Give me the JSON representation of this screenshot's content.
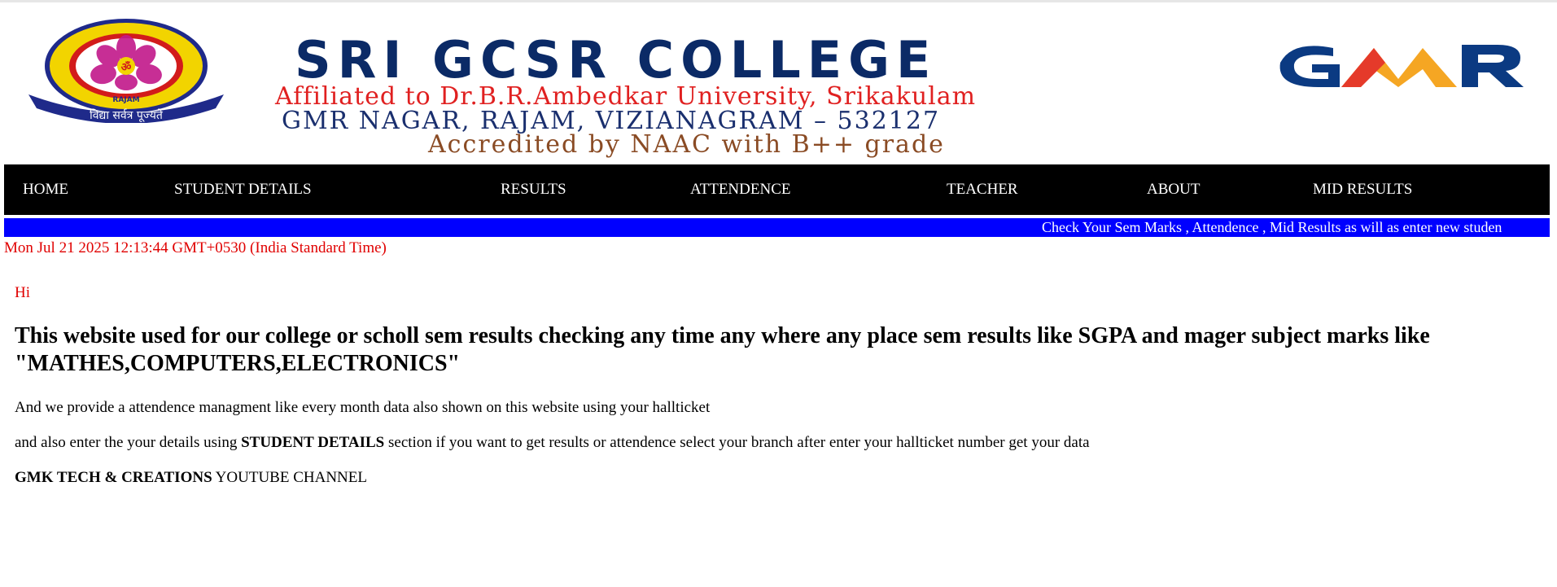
{
  "header": {
    "title": "SRI GCSR COLLEGE",
    "affiliation": "Affiliated to Dr.B.R.Ambedkar University, Srikakulam",
    "address": "GMR NAGAR, RAJAM, VIZIANAGRAM – 532127",
    "accreditation": "Accredited by NAAC with B++ grade",
    "logo_text_outer": "SRI GRANDHI CHINA SANYASIRAJU COLLEGE",
    "logo_text_inner": "RAJAM",
    "logo_motto": "विद्या सर्वत्र पूज्यते",
    "brand_logo_text": "GMR"
  },
  "nav": {
    "items": [
      {
        "label": "HOME"
      },
      {
        "label": "STUDENT DETAILS"
      },
      {
        "label": "RESULTS"
      },
      {
        "label": "ATTENDENCE"
      },
      {
        "label": "TEACHER"
      },
      {
        "label": "ABOUT"
      },
      {
        "label": "MID RESULTS"
      }
    ]
  },
  "marquee": {
    "text": "Check Your Sem Marks , Attendence , Mid Results as will as enter new studen"
  },
  "datetime": "Mon Jul 21 2025 12:13:44 GMT+0530 (India Standard Time)",
  "content": {
    "greeting": "Hi",
    "heading": "This website used for our college or scholl sem results checking any time any where any place sem results like SGPA and mager subject marks like \"MATHES,COMPUTERS,ELECTRONICS\"",
    "para1": "And we provide a attendence managment like every month data also shown on this website using your hallticket",
    "para2_before": "and also enter the your details using ",
    "para2_bold": "STUDENT DETAILS",
    "para2_after": " section if you want to get results or attendence select your branch after enter your hallticket number get your data",
    "para3_bold": "GMK TECH & CREATIONS",
    "para3_after": " YOUTUBE CHANNEL"
  },
  "colors": {
    "nav_bg": "#000000",
    "marquee_bg": "#0000ff",
    "title": "#0b2a66",
    "affiliation": "#e02020",
    "address": "#1a2f6e",
    "accreditation": "#8a4b24",
    "datetime": "#e00000"
  }
}
